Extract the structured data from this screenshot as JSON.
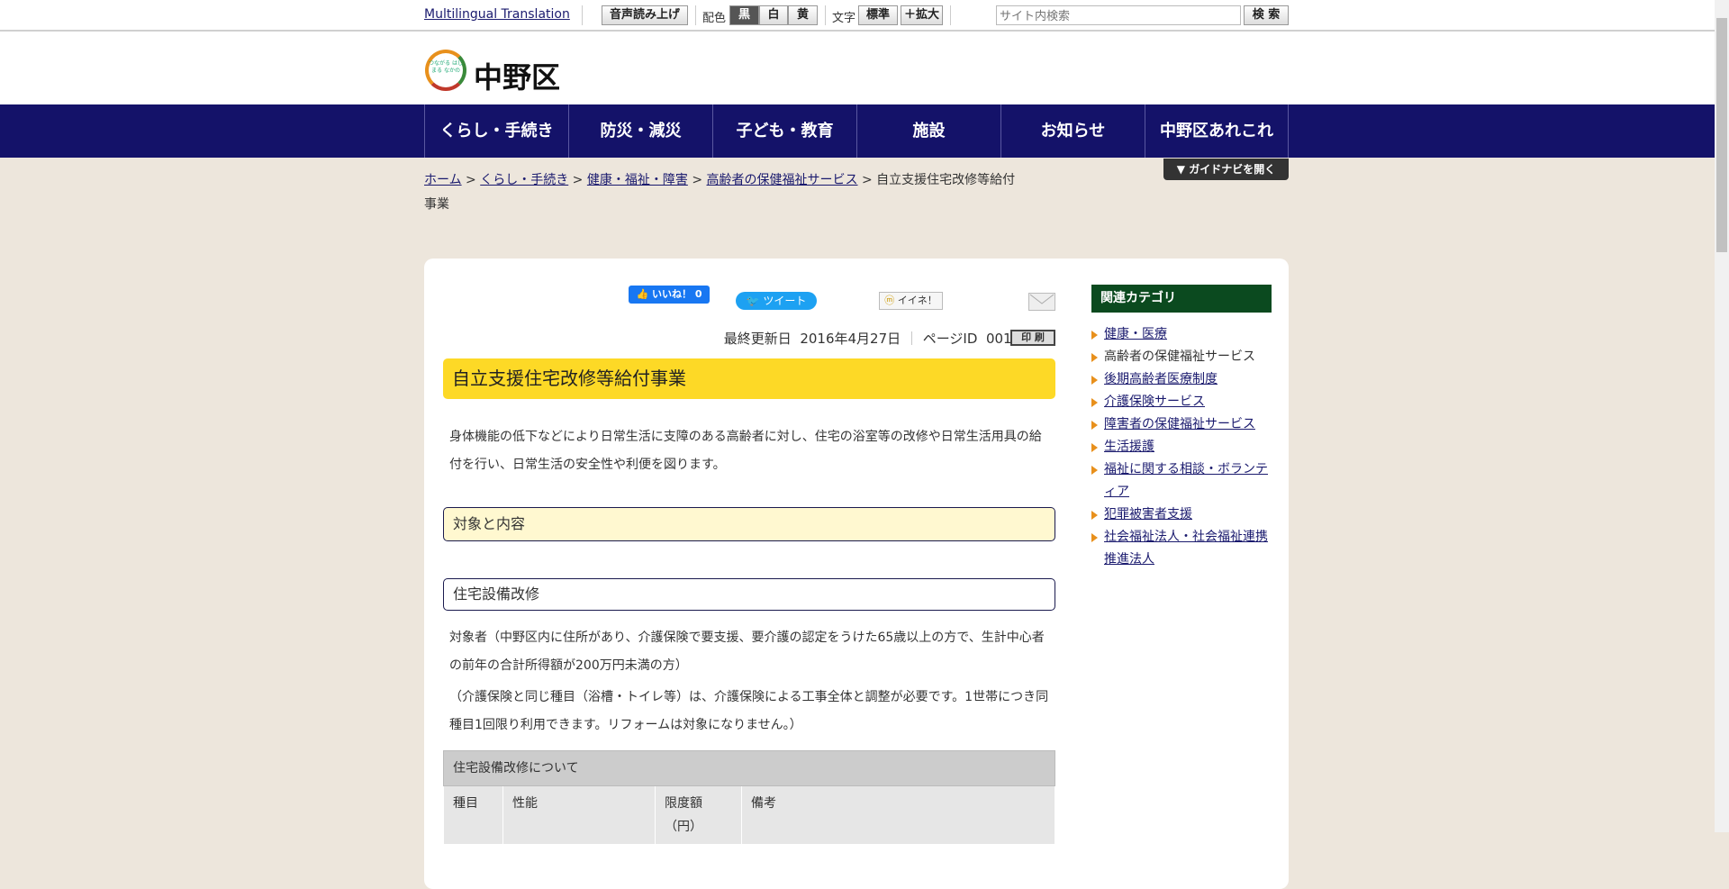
{
  "topbar": {
    "translation": "Multilingual Translation",
    "speech": "音声読み上げ",
    "color_label": "配色",
    "colors": [
      "黒",
      "白",
      "黄"
    ],
    "text_label": "文字",
    "text_standard": "標準",
    "text_enlarge": "＋拡大",
    "search_placeholder": "サイト内検索",
    "search_button": "検 索"
  },
  "header": {
    "logo_text": "中野区",
    "logo_tagline": "つながる はじまる なかの"
  },
  "nav": [
    "くらし・手続き",
    "防災・減災",
    "子ども・教育",
    "施設",
    "お知らせ",
    "中野区あれこれ"
  ],
  "guide_button": "ガイドナビを開く",
  "breadcrumb": {
    "items": [
      "ホーム",
      "くらし・手続き",
      "健康・福祉・障害",
      "高齢者の保健福祉サービス"
    ],
    "current": "自立支援住宅改修等給付事業"
  },
  "social": {
    "like": "いいね！ 0",
    "tweet": "ツイート",
    "mixi": "イイネ！"
  },
  "meta": {
    "updated_label": "最終更新日",
    "updated": "2016年4月27日",
    "page_id_label": "ページID",
    "page_id": "001832",
    "print": "印 刷"
  },
  "main": {
    "title": "自立支援住宅改修等給付事業",
    "intro": "身体機能の低下などにより日常生活に支障のある高齢者に対し、住宅の浴室等の改修や日常生活用具の給付を行い、日常生活の安全性や利便を図ります。",
    "section1": "対象と内容",
    "section2": "住宅設備改修",
    "para1": "対象者（中野区内に住所があり、介護保険で要支援、要介護の認定をうけた65歳以上の方で、生計中心者の前年の合計所得額が200万円未満の方）",
    "para2": "（介護保険と同じ種目（浴槽・トイレ等）は、介護保険による工事全体と調整が必要です。1世帯につき同種目1回限り利用できます。リフォームは対象になりません。）",
    "table": {
      "caption": "住宅設備改修について",
      "headers": [
        "種目",
        "性能",
        "限度額（円）",
        "備考"
      ]
    }
  },
  "sidebar": {
    "title": "関連カテゴリ",
    "items": [
      {
        "label": "健康・医療",
        "link": true
      },
      {
        "label": "高齢者の保健福祉サービス",
        "link": false
      },
      {
        "label": "後期高齢者医療制度",
        "link": true
      },
      {
        "label": "介護保険サービス",
        "link": true
      },
      {
        "label": "障害者の保健福祉サービス",
        "link": true
      },
      {
        "label": "生活援護",
        "link": true
      },
      {
        "label": "福祉に関する相談・ボランティア",
        "link": true
      },
      {
        "label": "犯罪被害者支援",
        "link": true
      },
      {
        "label": "社会福祉法人・社会福祉連携推進法人",
        "link": true
      }
    ]
  },
  "colors": {
    "nav": "#141269",
    "title_bg": "#fdd926",
    "section_bg": "#fff8d0",
    "sidebar_header": "#0b4a1f"
  }
}
